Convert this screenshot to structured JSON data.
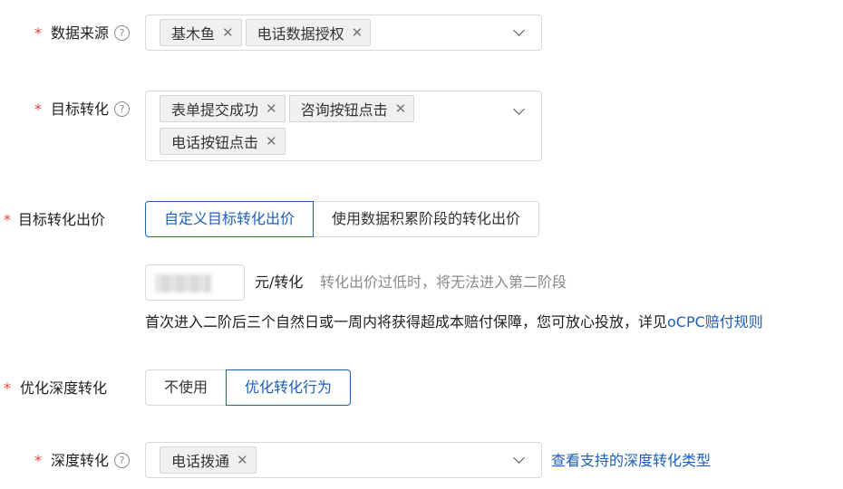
{
  "data_source": {
    "label": "数据来源",
    "tags": [
      "基木鱼",
      "电话数据授权"
    ]
  },
  "target_conversion": {
    "label": "目标转化",
    "tags": [
      "表单提交成功",
      "咨询按钮点击",
      "电话按钮点击"
    ]
  },
  "target_bid": {
    "label": "目标转化出价",
    "options": [
      "自定义目标转化出价",
      "使用数据积累阶段的转化出价"
    ],
    "unit": "元/转化",
    "hint": "转化出价过低时，将无法进入第二阶段",
    "guarantee_text": "首次进入二阶后三个自然日或一周内将获得超成本赔付保障，您可放心投放，详见",
    "guarantee_link": "oCPC赔付规则"
  },
  "deep_optimize": {
    "label": "优化深度转化",
    "options": [
      "不使用",
      "优化转化行为"
    ]
  },
  "deep_conversion": {
    "label": "深度转化",
    "tags": [
      "电话拨通"
    ],
    "link": "查看支持的深度转化类型"
  },
  "icons": {
    "required": "*",
    "help": "?",
    "remove": "✕"
  },
  "colors": {
    "accent": "#1e5fb8",
    "required": "#e8413c"
  }
}
